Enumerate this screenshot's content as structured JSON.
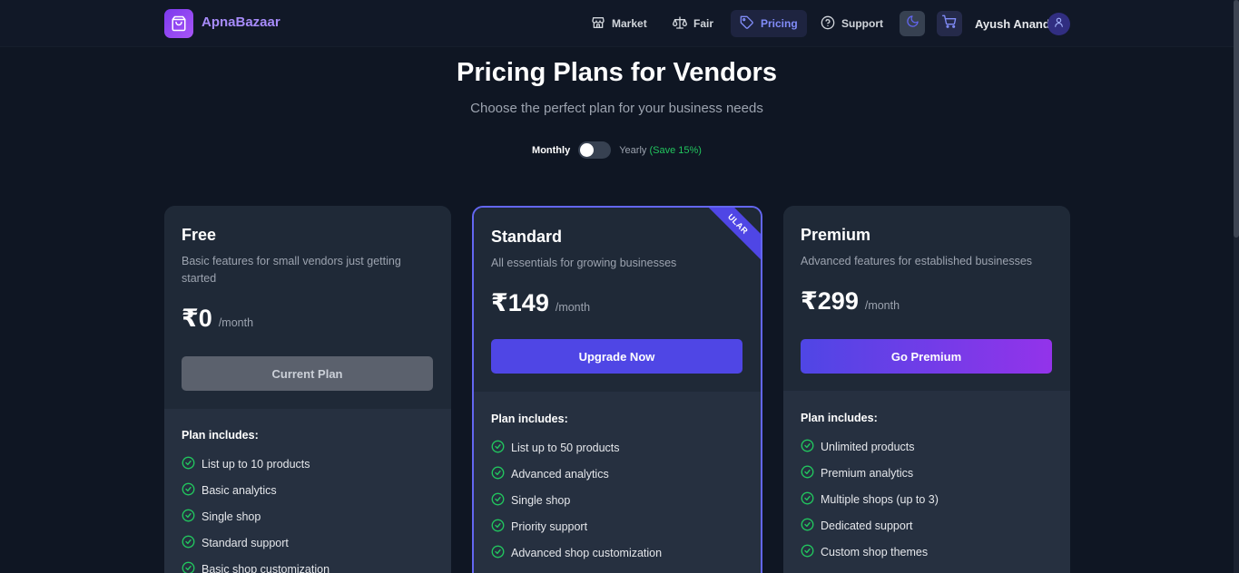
{
  "brand": {
    "name": "ApnaBazaar"
  },
  "nav": {
    "items": [
      {
        "label": "Market",
        "icon": "store-icon"
      },
      {
        "label": "Fair",
        "icon": "scale-icon"
      },
      {
        "label": "Pricing",
        "icon": "tag-icon",
        "active": true
      },
      {
        "label": "Support",
        "icon": "help-circle-icon"
      }
    ],
    "user_name": "Ayush Anand"
  },
  "header": {
    "title": "Pricing Plans for Vendors",
    "subtitle": "Choose the perfect plan for your business needs"
  },
  "billing": {
    "monthly_label": "Monthly",
    "yearly_label": "Yearly",
    "save_label": "(Save 15%)",
    "yearly_selected": false
  },
  "plans": [
    {
      "name": "Free",
      "description": "Basic features for small vendors just getting started",
      "price": "₹0",
      "period": "/month",
      "cta": "Current Plan",
      "includes_title": "Plan includes:",
      "features": [
        "List up to 10 products",
        "Basic analytics",
        "Single shop",
        "Standard support",
        "Basic shop customization"
      ]
    },
    {
      "name": "Standard",
      "description": "All essentials for growing businesses",
      "price": "₹149",
      "period": "/month",
      "cta": "Upgrade Now",
      "badge": "ULAR",
      "includes_title": "Plan includes:",
      "features": [
        "List up to 50 products",
        "Advanced analytics",
        "Single shop",
        "Priority support",
        "Advanced shop customization"
      ]
    },
    {
      "name": "Premium",
      "description": "Advanced features for established businesses",
      "price": "₹299",
      "period": "/month",
      "cta": "Go Premium",
      "includes_title": "Plan includes:",
      "features": [
        "Unlimited products",
        "Premium analytics",
        "Multiple shops (up to 3)",
        "Dedicated support",
        "Custom shop themes"
      ]
    }
  ],
  "colors": {
    "background": "#0f1623",
    "accent": "#4f46e5",
    "brand": "#a78bfa",
    "check": "#22c55e"
  }
}
